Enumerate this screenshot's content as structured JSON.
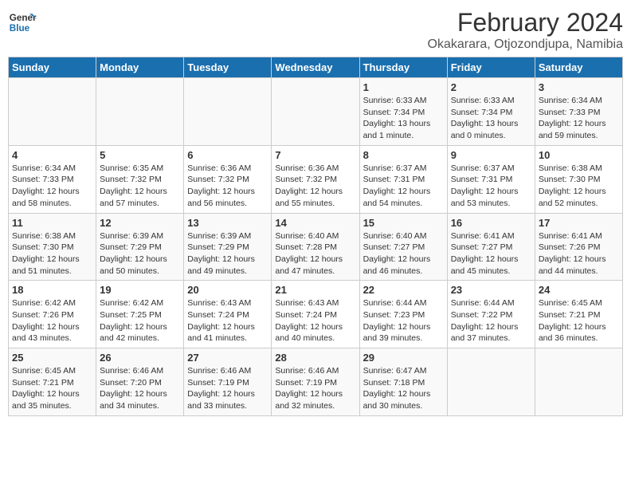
{
  "logo": {
    "line1": "General",
    "line2": "Blue"
  },
  "title": "February 2024",
  "location": "Okakarara, Otjozondjupa, Namibia",
  "days_of_week": [
    "Sunday",
    "Monday",
    "Tuesday",
    "Wednesday",
    "Thursday",
    "Friday",
    "Saturday"
  ],
  "weeks": [
    [
      {
        "day": "",
        "info": ""
      },
      {
        "day": "",
        "info": ""
      },
      {
        "day": "",
        "info": ""
      },
      {
        "day": "",
        "info": ""
      },
      {
        "day": "1",
        "info": "Sunrise: 6:33 AM\nSunset: 7:34 PM\nDaylight: 13 hours\nand 1 minute."
      },
      {
        "day": "2",
        "info": "Sunrise: 6:33 AM\nSunset: 7:34 PM\nDaylight: 13 hours\nand 0 minutes."
      },
      {
        "day": "3",
        "info": "Sunrise: 6:34 AM\nSunset: 7:33 PM\nDaylight: 12 hours\nand 59 minutes."
      }
    ],
    [
      {
        "day": "4",
        "info": "Sunrise: 6:34 AM\nSunset: 7:33 PM\nDaylight: 12 hours\nand 58 minutes."
      },
      {
        "day": "5",
        "info": "Sunrise: 6:35 AM\nSunset: 7:32 PM\nDaylight: 12 hours\nand 57 minutes."
      },
      {
        "day": "6",
        "info": "Sunrise: 6:36 AM\nSunset: 7:32 PM\nDaylight: 12 hours\nand 56 minutes."
      },
      {
        "day": "7",
        "info": "Sunrise: 6:36 AM\nSunset: 7:32 PM\nDaylight: 12 hours\nand 55 minutes."
      },
      {
        "day": "8",
        "info": "Sunrise: 6:37 AM\nSunset: 7:31 PM\nDaylight: 12 hours\nand 54 minutes."
      },
      {
        "day": "9",
        "info": "Sunrise: 6:37 AM\nSunset: 7:31 PM\nDaylight: 12 hours\nand 53 minutes."
      },
      {
        "day": "10",
        "info": "Sunrise: 6:38 AM\nSunset: 7:30 PM\nDaylight: 12 hours\nand 52 minutes."
      }
    ],
    [
      {
        "day": "11",
        "info": "Sunrise: 6:38 AM\nSunset: 7:30 PM\nDaylight: 12 hours\nand 51 minutes."
      },
      {
        "day": "12",
        "info": "Sunrise: 6:39 AM\nSunset: 7:29 PM\nDaylight: 12 hours\nand 50 minutes."
      },
      {
        "day": "13",
        "info": "Sunrise: 6:39 AM\nSunset: 7:29 PM\nDaylight: 12 hours\nand 49 minutes."
      },
      {
        "day": "14",
        "info": "Sunrise: 6:40 AM\nSunset: 7:28 PM\nDaylight: 12 hours\nand 47 minutes."
      },
      {
        "day": "15",
        "info": "Sunrise: 6:40 AM\nSunset: 7:27 PM\nDaylight: 12 hours\nand 46 minutes."
      },
      {
        "day": "16",
        "info": "Sunrise: 6:41 AM\nSunset: 7:27 PM\nDaylight: 12 hours\nand 45 minutes."
      },
      {
        "day": "17",
        "info": "Sunrise: 6:41 AM\nSunset: 7:26 PM\nDaylight: 12 hours\nand 44 minutes."
      }
    ],
    [
      {
        "day": "18",
        "info": "Sunrise: 6:42 AM\nSunset: 7:26 PM\nDaylight: 12 hours\nand 43 minutes."
      },
      {
        "day": "19",
        "info": "Sunrise: 6:42 AM\nSunset: 7:25 PM\nDaylight: 12 hours\nand 42 minutes."
      },
      {
        "day": "20",
        "info": "Sunrise: 6:43 AM\nSunset: 7:24 PM\nDaylight: 12 hours\nand 41 minutes."
      },
      {
        "day": "21",
        "info": "Sunrise: 6:43 AM\nSunset: 7:24 PM\nDaylight: 12 hours\nand 40 minutes."
      },
      {
        "day": "22",
        "info": "Sunrise: 6:44 AM\nSunset: 7:23 PM\nDaylight: 12 hours\nand 39 minutes."
      },
      {
        "day": "23",
        "info": "Sunrise: 6:44 AM\nSunset: 7:22 PM\nDaylight: 12 hours\nand 37 minutes."
      },
      {
        "day": "24",
        "info": "Sunrise: 6:45 AM\nSunset: 7:21 PM\nDaylight: 12 hours\nand 36 minutes."
      }
    ],
    [
      {
        "day": "25",
        "info": "Sunrise: 6:45 AM\nSunset: 7:21 PM\nDaylight: 12 hours\nand 35 minutes."
      },
      {
        "day": "26",
        "info": "Sunrise: 6:46 AM\nSunset: 7:20 PM\nDaylight: 12 hours\nand 34 minutes."
      },
      {
        "day": "27",
        "info": "Sunrise: 6:46 AM\nSunset: 7:19 PM\nDaylight: 12 hours\nand 33 minutes."
      },
      {
        "day": "28",
        "info": "Sunrise: 6:46 AM\nSunset: 7:19 PM\nDaylight: 12 hours\nand 32 minutes."
      },
      {
        "day": "29",
        "info": "Sunrise: 6:47 AM\nSunset: 7:18 PM\nDaylight: 12 hours\nand 30 minutes."
      },
      {
        "day": "",
        "info": ""
      },
      {
        "day": "",
        "info": ""
      }
    ]
  ]
}
